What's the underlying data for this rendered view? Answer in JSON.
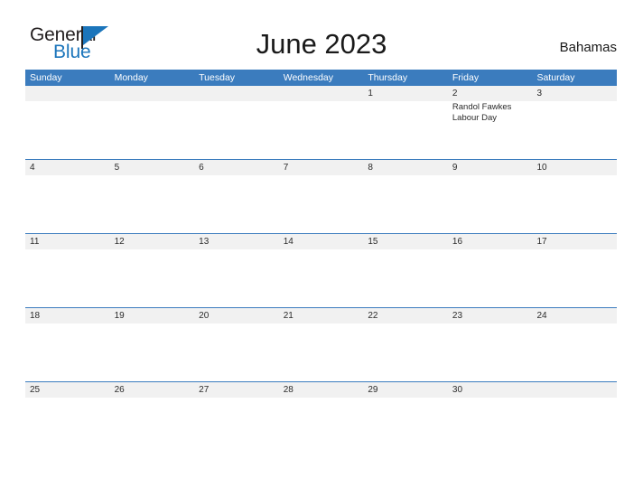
{
  "brand": {
    "name_part1": "General",
    "name_part2": "Blue",
    "flag_icon": "flag-triangle-icon",
    "primary_color": "#1b75bb",
    "text_color": "#231f20"
  },
  "header": {
    "title": "June 2023",
    "country": "Bahamas"
  },
  "calendar": {
    "header_bg_color": "#3b7cbe",
    "date_band_color": "#f1f1f1",
    "rule_color": "#3b7cbe",
    "weekdays": [
      "Sunday",
      "Monday",
      "Tuesday",
      "Wednesday",
      "Thursday",
      "Friday",
      "Saturday"
    ],
    "weeks": [
      {
        "dates": [
          "",
          "",
          "",
          "",
          "1",
          "2",
          "3"
        ],
        "events": [
          "",
          "",
          "",
          "",
          "",
          "Randol Fawkes Labour Day",
          ""
        ]
      },
      {
        "dates": [
          "4",
          "5",
          "6",
          "7",
          "8",
          "9",
          "10"
        ],
        "events": [
          "",
          "",
          "",
          "",
          "",
          "",
          ""
        ]
      },
      {
        "dates": [
          "11",
          "12",
          "13",
          "14",
          "15",
          "16",
          "17"
        ],
        "events": [
          "",
          "",
          "",
          "",
          "",
          "",
          ""
        ]
      },
      {
        "dates": [
          "18",
          "19",
          "20",
          "21",
          "22",
          "23",
          "24"
        ],
        "events": [
          "",
          "",
          "",
          "",
          "",
          "",
          ""
        ]
      },
      {
        "dates": [
          "25",
          "26",
          "27",
          "28",
          "29",
          "30",
          ""
        ],
        "events": [
          "",
          "",
          "",
          "",
          "",
          "",
          ""
        ]
      }
    ]
  }
}
